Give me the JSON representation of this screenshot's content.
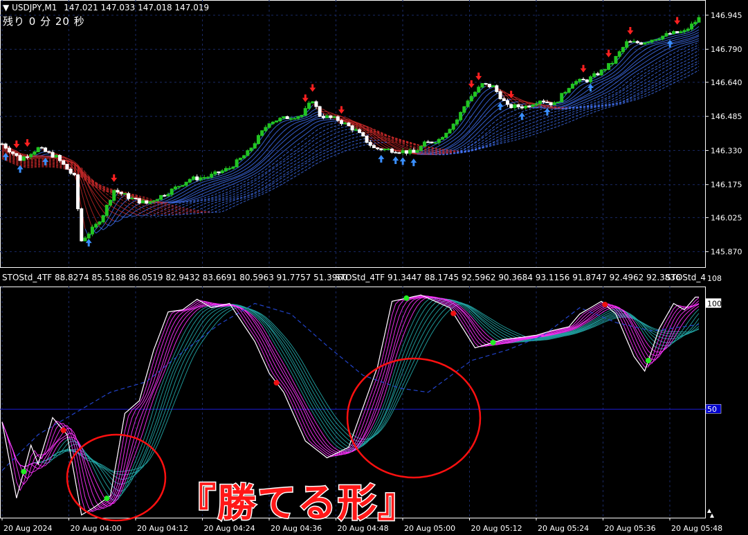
{
  "header": {
    "symbol": "USDJPY,M1",
    "ohlc": "147.021 147.033 147.018 147.019",
    "countdown": "残り 0 分 20 秒"
  },
  "indicator": {
    "label": "STOStd_4TF 88.8274 85.5188 86.0519 82.9432 83.6691 80.5963 91.7757 51.3960",
    "label2": "STOStd_4TF 91.3447 88.1745 92.5962 90.3684 93.1156 91.8747 92.4962 92.3836",
    "label3": "STOStd_4",
    "scale_top": "108",
    "scale_100": "100",
    "scale_50": "50"
  },
  "annotation": "『勝てる形』",
  "colors": {
    "bg": "#000000",
    "grid": "#1a2a66",
    "bull": "#22c522",
    "bear": "#ffffff",
    "ma_up": "#4477ff",
    "ma_down": "#cc2a2a",
    "arrow_sell": "#ff2020",
    "arrow_buy": "#3a8fff",
    "stoch_main": "#ffffff",
    "stoch_magenta": "#ff33ff",
    "stoch_teal": "#22a6a6",
    "stoch_blue": "#2244cc",
    "circle": "#ff1010"
  },
  "chart_data": [
    {
      "type": "candlestick",
      "symbol": "USDJPY",
      "timeframe": "M1",
      "y_ticks": [
        "146.945",
        "146.790",
        "146.640",
        "146.485",
        "146.330",
        "146.175",
        "146.025",
        "145.870"
      ],
      "ylim": [
        145.85,
        146.97
      ],
      "x_ticks": [
        "20 Aug 2024",
        "20 Aug 04:00",
        "20 Aug 04:12",
        "20 Aug 04:24",
        "20 Aug 04:36",
        "20 Aug 04:48",
        "20 Aug 05:00",
        "20 Aug 05:12",
        "20 Aug 05:24",
        "20 Aug 05:36",
        "20 Aug 05:48"
      ],
      "close_path": [
        [
          0,
          146.36
        ],
        [
          5,
          146.29
        ],
        [
          10,
          146.34
        ],
        [
          15,
          146.3
        ],
        [
          20,
          146.21
        ],
        [
          22,
          145.92
        ],
        [
          26,
          145.99
        ],
        [
          28,
          146.04
        ],
        [
          31,
          146.15
        ],
        [
          36,
          146.11
        ],
        [
          40,
          146.09
        ],
        [
          46,
          146.14
        ],
        [
          52,
          146.2
        ],
        [
          57,
          146.21
        ],
        [
          63,
          146.25
        ],
        [
          68,
          146.32
        ],
        [
          74,
          146.46
        ],
        [
          79,
          146.48
        ],
        [
          83,
          146.49
        ],
        [
          86,
          146.56
        ],
        [
          88,
          146.49
        ],
        [
          93,
          146.47
        ],
        [
          98,
          146.42
        ],
        [
          103,
          146.34
        ],
        [
          109,
          146.33
        ],
        [
          114,
          146.32
        ],
        [
          117,
          146.36
        ],
        [
          121,
          146.38
        ],
        [
          126,
          146.47
        ],
        [
          129,
          146.56
        ],
        [
          133,
          146.63
        ],
        [
          136,
          146.62
        ],
        [
          140,
          146.53
        ],
        [
          145,
          146.53
        ],
        [
          149,
          146.56
        ],
        [
          153,
          146.54
        ],
        [
          158,
          146.64
        ],
        [
          162,
          146.65
        ],
        [
          166,
          146.69
        ],
        [
          169,
          146.73
        ],
        [
          173,
          146.82
        ],
        [
          177,
          146.82
        ],
        [
          181,
          146.84
        ],
        [
          185,
          146.86
        ],
        [
          189,
          146.87
        ],
        [
          193,
          146.93
        ]
      ],
      "sell_arrow_bars": [
        4,
        7,
        31,
        84,
        86,
        94,
        130,
        132,
        141,
        161,
        168,
        174,
        187
      ],
      "buy_arrow_bars": [
        1,
        5,
        12,
        24,
        105,
        109,
        111,
        114,
        138,
        144,
        151,
        163,
        185
      ]
    },
    {
      "type": "line",
      "name": "STOStd_4TF",
      "ylim": [
        0,
        108
      ],
      "y_ticks": [
        "108",
        "100",
        "50"
      ],
      "level": 50,
      "stoch_path": [
        [
          0,
          44
        ],
        [
          4,
          8
        ],
        [
          8,
          33
        ],
        [
          10,
          24
        ],
        [
          14,
          46
        ],
        [
          18,
          38
        ],
        [
          22,
          0
        ],
        [
          25,
          3
        ],
        [
          30,
          9
        ],
        [
          34,
          48
        ],
        [
          38,
          54
        ],
        [
          42,
          78
        ],
        [
          46,
          96
        ],
        [
          50,
          97
        ],
        [
          54,
          102
        ],
        [
          58,
          98
        ],
        [
          63,
          100
        ],
        [
          70,
          82
        ],
        [
          74,
          67
        ],
        [
          78,
          58
        ],
        [
          84,
          35
        ],
        [
          90,
          27
        ],
        [
          96,
          32
        ],
        [
          104,
          70
        ],
        [
          108,
          101
        ],
        [
          116,
          104
        ],
        [
          124,
          98
        ],
        [
          131,
          79
        ],
        [
          135,
          81
        ],
        [
          139,
          83
        ],
        [
          144,
          84
        ],
        [
          148,
          85
        ],
        [
          152,
          87
        ],
        [
          157,
          89
        ],
        [
          160,
          95
        ],
        [
          166,
          101
        ],
        [
          170,
          95
        ],
        [
          175,
          75
        ],
        [
          178,
          68
        ],
        [
          182,
          88
        ],
        [
          186,
          100
        ],
        [
          189,
          97
        ],
        [
          192,
          103
        ]
      ],
      "signal_path": [
        [
          0,
          21
        ],
        [
          10,
          38
        ],
        [
          20,
          48
        ],
        [
          30,
          58
        ],
        [
          40,
          63
        ],
        [
          50,
          77
        ],
        [
          60,
          90
        ],
        [
          70,
          100
        ],
        [
          80,
          95
        ],
        [
          90,
          80
        ],
        [
          100,
          66
        ],
        [
          110,
          60
        ],
        [
          118,
          58
        ],
        [
          130,
          73
        ],
        [
          140,
          78
        ],
        [
          150,
          85
        ],
        [
          160,
          98
        ],
        [
          170,
          91
        ],
        [
          180,
          87
        ],
        [
          193,
          90
        ]
      ],
      "green_dot_bars": [
        6,
        29,
        112,
        136,
        179
      ],
      "red_dot_bars": [
        17,
        76,
        125,
        167
      ]
    }
  ]
}
